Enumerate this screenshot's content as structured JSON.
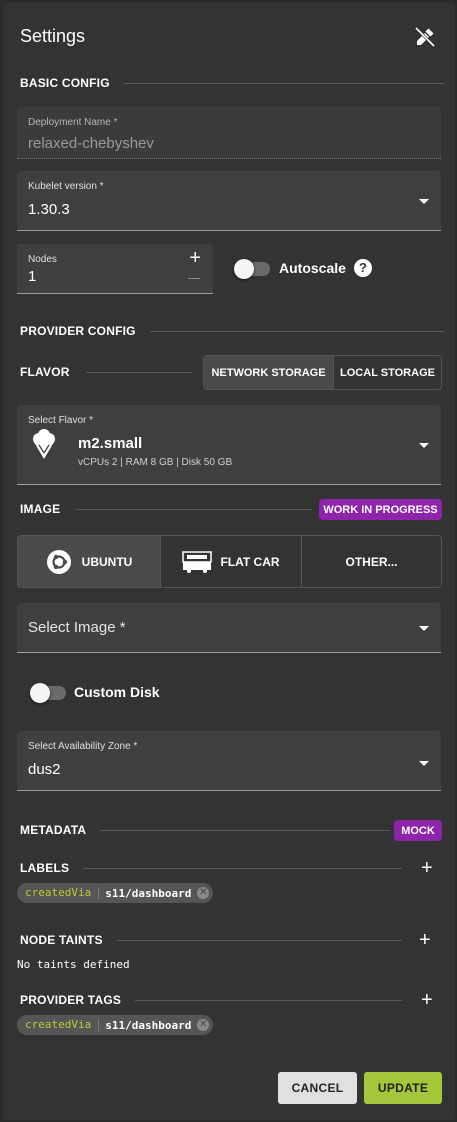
{
  "header": {
    "title": "Settings",
    "close_icon": "close-edit-icon"
  },
  "basic_config": {
    "section_title": "BASIC CONFIG",
    "deployment_name": {
      "label": "Deployment Name *",
      "value": "relaxed-chebyshev"
    },
    "kubelet_version": {
      "label": "Kubelet version *",
      "value": "1.30.3"
    },
    "nodes": {
      "label": "Nodes",
      "value": "1"
    },
    "autoscale": {
      "label": "Autoscale",
      "enabled": false,
      "help": "?"
    }
  },
  "provider_config": {
    "section_title": "PROVIDER CONFIG",
    "flavor": {
      "label": "FLAVOR",
      "storage_options": [
        "NETWORK STORAGE",
        "LOCAL STORAGE"
      ],
      "selected_storage": "NETWORK STORAGE",
      "select_label": "Select Flavor *",
      "name": "m2.small",
      "specs": "vCPUs 2 | RAM 8 GB | Disk 50 GB",
      "icon": "ice-cream-icon"
    },
    "image": {
      "label": "IMAGE",
      "badge": "WORK IN PROGRESS",
      "options": [
        "UBUNTU",
        "FLAT CAR",
        "OTHER..."
      ],
      "selected": "UBUNTU",
      "select_placeholder": "Select Image *"
    },
    "custom_disk": {
      "label": "Custom Disk",
      "enabled": false
    },
    "availability_zone": {
      "label": "Select Availability Zone *",
      "value": "dus2"
    }
  },
  "metadata": {
    "section_title": "METADATA",
    "badge": "MOCK",
    "labels": {
      "title": "LABELS",
      "items": [
        {
          "key": "createdVia",
          "value": "s11/dashboard"
        }
      ]
    },
    "node_taints": {
      "title": "NODE TAINTS",
      "empty_text": "No taints defined"
    },
    "provider_tags": {
      "title": "PROVIDER TAGS",
      "items": [
        {
          "key": "createdVia",
          "value": "s11/dashboard"
        }
      ]
    }
  },
  "actions": {
    "cancel": "CANCEL",
    "update": "UPDATE"
  },
  "colors": {
    "panel": "#333333",
    "badge": "#8e24aa",
    "update": "#a4c639",
    "chip_key": "#c0ca33"
  }
}
